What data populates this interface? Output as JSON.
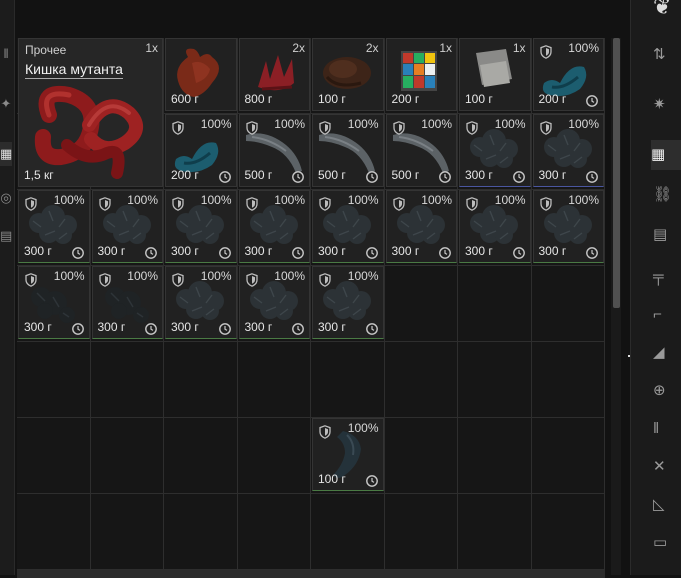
{
  "selected_item": {
    "category": "Прочее",
    "name": "Кишка мутанта",
    "quantity": "1x",
    "weight": "1,5 кг"
  },
  "items": [
    {
      "id": "heart",
      "qty": "",
      "weight": "600 г",
      "pct": "",
      "kind": "heart"
    },
    {
      "id": "spikes",
      "qty": "2x",
      "weight": "800 г",
      "pct": "",
      "kind": "spikes"
    },
    {
      "id": "fur",
      "qty": "2x",
      "weight": "100 г",
      "pct": "",
      "kind": "fur"
    },
    {
      "id": "cube",
      "qty": "1x",
      "weight": "200 г",
      "pct": "",
      "kind": "cube"
    },
    {
      "id": "pack",
      "qty": "1x",
      "weight": "100 г",
      "pct": "",
      "kind": "pack"
    },
    {
      "id": "r1c8",
      "qty": "",
      "weight": "200 г",
      "pct": "100%",
      "kind": "tealstem"
    },
    {
      "id": "r2c3",
      "qty": "",
      "weight": "200 г",
      "pct": "100%",
      "kind": "tealstem"
    },
    {
      "id": "r2c4",
      "qty": "",
      "weight": "500 г",
      "pct": "100%",
      "kind": "stick"
    },
    {
      "id": "r2c5",
      "qty": "",
      "weight": "500 г",
      "pct": "100%",
      "kind": "stick"
    },
    {
      "id": "r2c6",
      "qty": "",
      "weight": "500 г",
      "pct": "100%",
      "kind": "stick"
    },
    {
      "id": "r2c7",
      "qty": "",
      "weight": "300 г",
      "pct": "100%",
      "kind": "moss"
    },
    {
      "id": "r2c8",
      "qty": "",
      "weight": "300 г",
      "pct": "100%",
      "kind": "moss"
    },
    {
      "id": "r3c1",
      "qty": "",
      "weight": "300 г",
      "pct": "100%",
      "kind": "moss"
    },
    {
      "id": "r3c2",
      "qty": "",
      "weight": "300 г",
      "pct": "100%",
      "kind": "moss"
    },
    {
      "id": "r3c3",
      "qty": "",
      "weight": "300 г",
      "pct": "100%",
      "kind": "moss"
    },
    {
      "id": "r3c4",
      "qty": "",
      "weight": "300 г",
      "pct": "100%",
      "kind": "moss"
    },
    {
      "id": "r3c5",
      "qty": "",
      "weight": "300 г",
      "pct": "100%",
      "kind": "moss"
    },
    {
      "id": "r3c6",
      "qty": "",
      "weight": "300 г",
      "pct": "100%",
      "kind": "moss"
    },
    {
      "id": "r3c7",
      "qty": "",
      "weight": "300 г",
      "pct": "100%",
      "kind": "moss"
    },
    {
      "id": "r3c8",
      "qty": "",
      "weight": "300 г",
      "pct": "100%",
      "kind": "moss"
    },
    {
      "id": "r4c1",
      "qty": "",
      "weight": "300 г",
      "pct": "100%",
      "kind": "darkmoss"
    },
    {
      "id": "r4c2",
      "qty": "",
      "weight": "300 г",
      "pct": "100%",
      "kind": "darkmoss"
    },
    {
      "id": "r4c3",
      "qty": "",
      "weight": "300 г",
      "pct": "100%",
      "kind": "moss"
    },
    {
      "id": "r4c4",
      "qty": "",
      "weight": "300 г",
      "pct": "100%",
      "kind": "moss"
    },
    {
      "id": "r4c5",
      "qty": "",
      "weight": "300 г",
      "pct": "100%",
      "kind": "moss"
    },
    {
      "id": "r6c5",
      "qty": "",
      "weight": "100 г",
      "pct": "100%",
      "kind": "claw"
    }
  ],
  "colors": {
    "border_green": "#4a7a44",
    "border_blue": "#4a56a0",
    "cell_bg": "#161616"
  }
}
